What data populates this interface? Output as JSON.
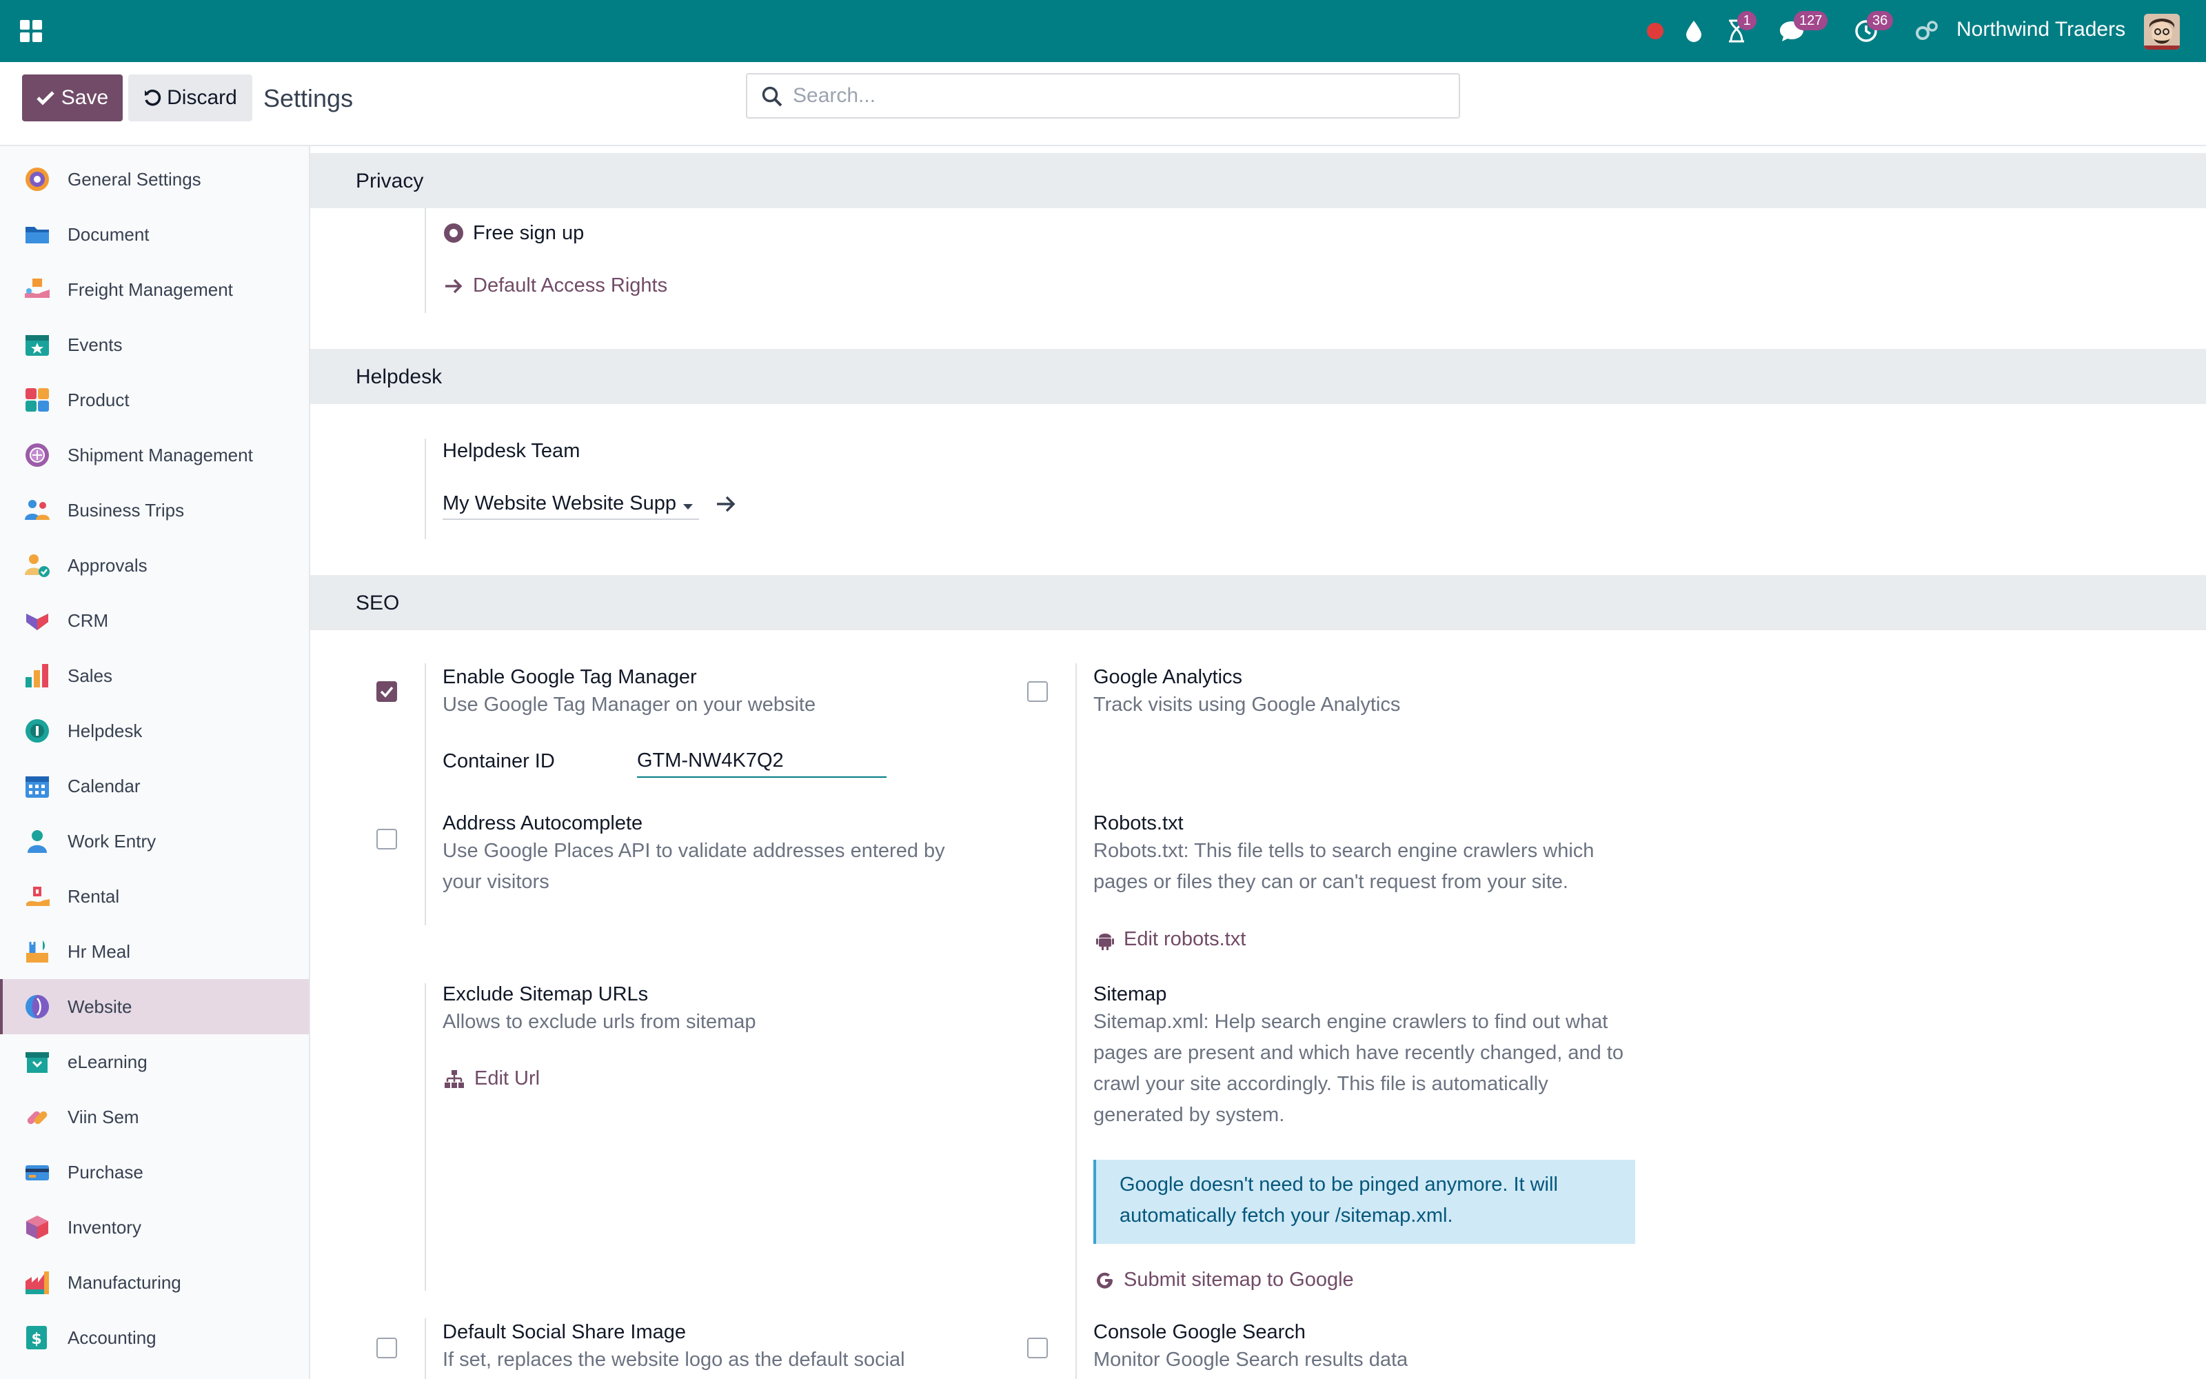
{
  "navbar": {
    "company": "Northwind Traders",
    "activity_badge": "1",
    "messages_badge": "127",
    "clock_badge": "36"
  },
  "control": {
    "save_label": "Save",
    "discard_label": "Discard",
    "title": "Settings",
    "search_placeholder": "Search..."
  },
  "sidebar": {
    "items": [
      {
        "label": "General Settings",
        "icon": "general-settings-icon"
      },
      {
        "label": "Document",
        "icon": "folder-icon"
      },
      {
        "label": "Freight Management",
        "icon": "freight-icon"
      },
      {
        "label": "Events",
        "icon": "events-icon"
      },
      {
        "label": "Product",
        "icon": "product-icon"
      },
      {
        "label": "Shipment Management",
        "icon": "shipment-icon"
      },
      {
        "label": "Business Trips",
        "icon": "business-trips-icon"
      },
      {
        "label": "Approvals",
        "icon": "approvals-icon"
      },
      {
        "label": "CRM",
        "icon": "crm-icon"
      },
      {
        "label": "Sales",
        "icon": "sales-icon"
      },
      {
        "label": "Helpdesk",
        "icon": "helpdesk-icon"
      },
      {
        "label": "Calendar",
        "icon": "calendar-icon"
      },
      {
        "label": "Work Entry",
        "icon": "work-entry-icon"
      },
      {
        "label": "Rental",
        "icon": "rental-icon"
      },
      {
        "label": "Hr Meal",
        "icon": "hr-meal-icon"
      },
      {
        "label": "Website",
        "icon": "website-icon"
      },
      {
        "label": "eLearning",
        "icon": "elearning-icon"
      },
      {
        "label": "Viin Sem",
        "icon": "viin-sem-icon"
      },
      {
        "label": "Purchase",
        "icon": "purchase-icon"
      },
      {
        "label": "Inventory",
        "icon": "inventory-icon"
      },
      {
        "label": "Manufacturing",
        "icon": "manufacturing-icon"
      },
      {
        "label": "Accounting",
        "icon": "accounting-icon"
      }
    ],
    "active": "Website"
  },
  "privacy": {
    "header": "Privacy",
    "option_label": "Free sign up",
    "link_label": "Default Access Rights"
  },
  "helpdesk": {
    "header": "Helpdesk",
    "team_label": "Helpdesk Team",
    "team_value": "My Website Website Supp"
  },
  "seo": {
    "header": "SEO",
    "gtm": {
      "title": "Enable Google Tag Manager",
      "desc": "Use Google Tag Manager on your website",
      "checked": true,
      "container_label": "Container ID",
      "container_value": "GTM-NW4K7Q2"
    },
    "analytics": {
      "title": "Google Analytics",
      "desc": "Track visits using Google Analytics",
      "checked": false
    },
    "autocomplete": {
      "title": "Address Autocomplete",
      "desc_line1": "Use Google Places API to validate addresses entered by",
      "desc_line2": "your visitors",
      "checked": false
    },
    "robots": {
      "title": "Robots.txt",
      "desc_line1": "Robots.txt: This file tells to search engine crawlers which",
      "desc_line2": "pages or files they can or can't request from your site.",
      "link_label": "Edit robots.txt"
    },
    "exclude_sitemap": {
      "title": "Exclude Sitemap URLs",
      "desc": "Allows to exclude urls from sitemap",
      "link_label": "Edit Url"
    },
    "sitemap": {
      "title": "Sitemap",
      "desc_line1": "Sitemap.xml: Help search engine crawlers to find out what",
      "desc_line2": "pages are present and which have recently changed, and to",
      "desc_line3": "crawl your site accordingly. This file is automatically",
      "desc_line4": "generated by system.",
      "alert_line1": "Google doesn't need to be pinged anymore. It will",
      "alert_line2": "automatically fetch your /sitemap.xml.",
      "link_label": "Submit sitemap to Google"
    },
    "social_image": {
      "title": "Default Social Share Image",
      "desc": "If set, replaces the website logo as the default social",
      "checked": false
    },
    "console": {
      "title": "Console Google Search",
      "desc": "Monitor Google Search results data",
      "checked": false
    }
  }
}
